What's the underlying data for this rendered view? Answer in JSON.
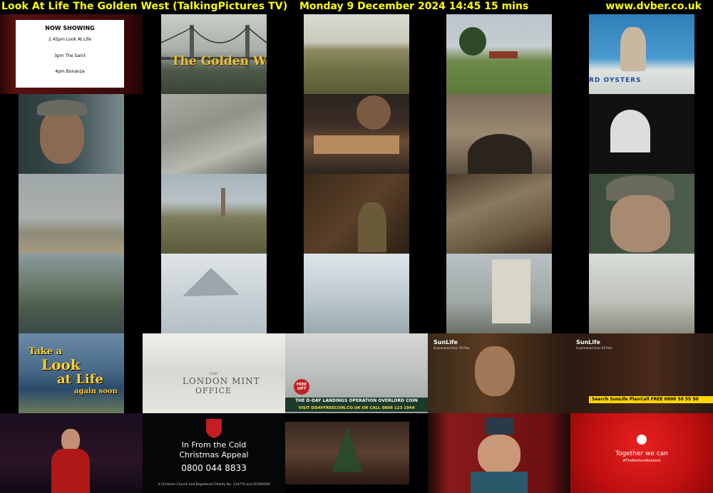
{
  "header": {
    "title": "Look At Life The Golden West (TalkingPictures TV)",
    "datetime": "Monday 9 December 2024  14:45  15 mins",
    "site": "www.dvber.co.uk"
  },
  "now_showing": {
    "heading": "NOW SHOWING",
    "items": [
      "2.45pm Look At Life",
      "3pm The Saint",
      "4pm Bonanza"
    ]
  },
  "tile_texts": {
    "golden_west": "The Golden West",
    "oysters": "RD OYSTERS",
    "take_a": "Take a",
    "look": "Look",
    "at_life": "at Life",
    "again_soon": "again soon",
    "mint_the": "THE",
    "mint_name": "LONDON MINT",
    "mint_office": "OFFICE",
    "coin_title": "THE D-DAY LANDINGS OPERATION OVERLORD COIN",
    "coin_visit": "VISIT DDAYFREECOIN.CO.UK  OR CALL 0808 123 1944",
    "free_gift": "FREE GIFT",
    "sunlife1": "SunLife",
    "sunlife1_sub": "Guaranteed Over 50 Plan",
    "sunlife2": "SunLife",
    "sunlife2_sub": "Guaranteed Over 50 Plan",
    "sunlife2_search": "Search  SunLife Plan",
    "sunlife2_call": "Call FREE 0800 50 55 50",
    "salvation_line1": "In From the Cold",
    "salvation_line2": "Christmas Appeal",
    "salvation_phone": "0800 044 8833",
    "salvation_footer": "A Christian Church and Registered Charity No. 214779 and SC009359",
    "vodafone_line1": "Together we can",
    "vodafone_line2": "#TheNationsNetwork"
  }
}
